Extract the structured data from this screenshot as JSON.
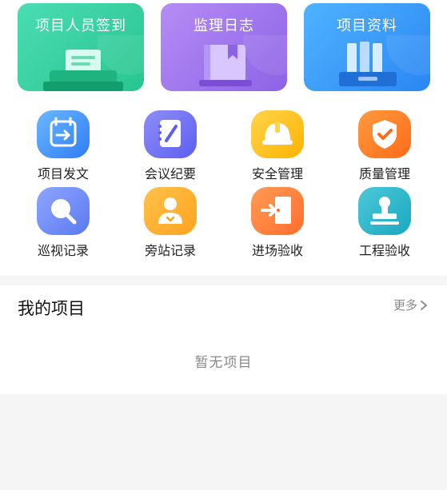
{
  "cards": [
    {
      "label": "项目人员签到"
    },
    {
      "label": "监理日志"
    },
    {
      "label": "项目资料"
    }
  ],
  "grid": [
    {
      "label": "项目发文",
      "icon": "send-document-icon"
    },
    {
      "label": "会议纪要",
      "icon": "meeting-notes-icon"
    },
    {
      "label": "安全管理",
      "icon": "safety-helmet-icon"
    },
    {
      "label": "质量管理",
      "icon": "quality-shield-icon"
    },
    {
      "label": "巡视记录",
      "icon": "inspection-search-icon"
    },
    {
      "label": "旁站记录",
      "icon": "supervisor-person-icon"
    },
    {
      "label": "进场验收",
      "icon": "entry-door-icon"
    },
    {
      "label": "工程验收",
      "icon": "acceptance-stamp-icon"
    }
  ],
  "projects": {
    "title": "我的项目",
    "more": "更多",
    "empty": "暂无项目"
  }
}
